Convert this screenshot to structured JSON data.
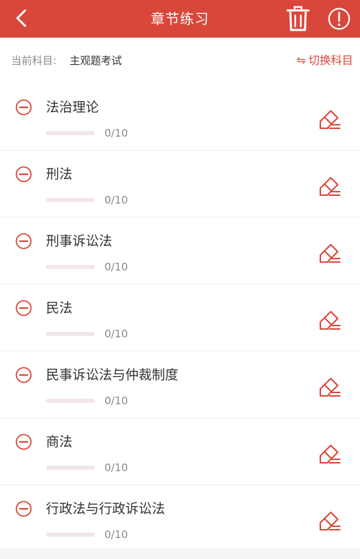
{
  "header": {
    "title": "章节练习",
    "back_icon": "chevron-left-icon",
    "delete_icon": "trash-icon",
    "info_icon": "info-icon",
    "color": "#d9473a"
  },
  "subject": {
    "label": "当前科目:",
    "value": "主观题考试",
    "switch_label": "切换科目",
    "switch_icon": "swap-arrows-icon"
  },
  "chapters": [
    {
      "name": "法治理论",
      "progress": "0/10",
      "done": 0,
      "total": 10
    },
    {
      "name": "刑法",
      "progress": "0/10",
      "done": 0,
      "total": 10
    },
    {
      "name": "刑事诉讼法",
      "progress": "0/10",
      "done": 0,
      "total": 10
    },
    {
      "name": "民法",
      "progress": "0/10",
      "done": 0,
      "total": 10
    },
    {
      "name": "民事诉讼法与仲裁制度",
      "progress": "0/10",
      "done": 0,
      "total": 10
    },
    {
      "name": "商法",
      "progress": "0/10",
      "done": 0,
      "total": 10
    },
    {
      "name": "行政法与行政诉讼法",
      "progress": "0/10",
      "done": 0,
      "total": 10
    }
  ]
}
